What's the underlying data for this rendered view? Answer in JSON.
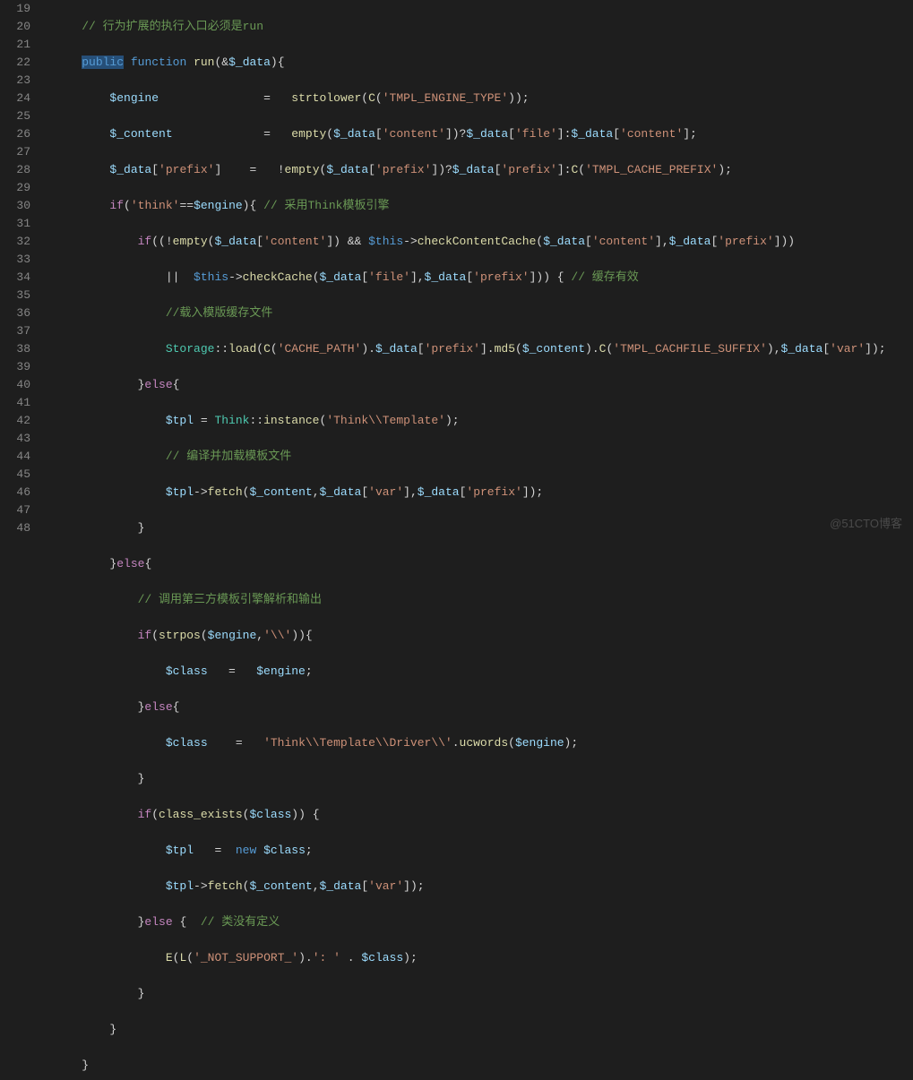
{
  "line_start": 19,
  "line_end": 48,
  "watermark": "@51CTO博客",
  "lines": {
    "l19": {
      "indent": "    ",
      "cmt": "// 行为扩展的执行入口必须是run"
    },
    "l20": {
      "indent": "    ",
      "pub": "public",
      "fn": "function",
      "name": "run",
      "op1": "(&",
      "var": "$_data",
      "op2": "){"
    },
    "l21": {
      "indent": "        ",
      "v1": "$engine",
      "pad": "               ",
      "eq": "=   ",
      "fn": "strtolower",
      "o1": "(",
      "fn2": "C",
      "o2": "(",
      "s": "'TMPL_ENGINE_TYPE'",
      "o3": "));"
    },
    "l22": {
      "indent": "        ",
      "v": "$_content",
      "pad": "             ",
      "eq": "=   ",
      "fn": "empty",
      "o1": "(",
      "v2": "$_data",
      "o2": "[",
      "s1": "'content'",
      "o3": "])?",
      "v3": "$_data",
      "o4": "[",
      "s2": "'file'",
      "o5": "]:",
      "v4": "$_data",
      "o6": "[",
      "s3": "'content'",
      "o7": "];"
    },
    "l23": {
      "indent": "        ",
      "v": "$_data",
      "o1": "[",
      "s1": "'prefix'",
      "o2": "]",
      "pad": "    ",
      "eq": "=   !",
      "fn": "empty",
      "o3": "(",
      "v2": "$_data",
      "o4": "[",
      "s2": "'prefix'",
      "o5": "])?",
      "v3": "$_data",
      "o6": "[",
      "s3": "'prefix'",
      "o7": "]:",
      "fn2": "C",
      "o8": "(",
      "s4": "'TMPL_CACHE_PREFIX'",
      "o9": ");"
    },
    "l24": {
      "indent": "        ",
      "if": "if",
      "o1": "(",
      "s": "'think'",
      "op": "==",
      "v": "$engine",
      "o2": "){ ",
      "cmt": "// 采用Think模板引擎"
    },
    "l25": {
      "indent": "            ",
      "if": "if",
      "o1": "((!",
      "fn": "empty",
      "o2": "(",
      "v1": "$_data",
      "o3": "[",
      "s1": "'content'",
      "o4": "]) && ",
      "th": "$this",
      "o5": "->",
      "fn2": "checkContentCache",
      "o6": "(",
      "v2": "$_data",
      "o7": "[",
      "s2": "'content'",
      "o8": "],",
      "v3": "$_data",
      "o9": "[",
      "s3": "'prefix'",
      "o10": "]))"
    },
    "l26": {
      "indent": "                ",
      "o1": "||  ",
      "th": "$this",
      "o2": "->",
      "fn": "checkCache",
      "o3": "(",
      "v1": "$_data",
      "o4": "[",
      "s1": "'file'",
      "o5": "],",
      "v2": "$_data",
      "o6": "[",
      "s2": "'prefix'",
      "o7": "])) { ",
      "cmt": "// 缓存有效"
    },
    "l27": {
      "indent": "                ",
      "cmt": "//载入模版缓存文件"
    },
    "l28": {
      "indent": "                ",
      "cls": "Storage",
      "o1": "::",
      "fn": "load",
      "o2": "(",
      "fn2": "C",
      "o3": "(",
      "s1": "'CACHE_PATH'",
      "o4": ").",
      "v1": "$_data",
      "o5": "[",
      "s2": "'prefix'",
      "o6": "].",
      "fn3": "md5",
      "o7": "(",
      "v2": "$_content",
      "o8": ").",
      "fn4": "C",
      "o9": "(",
      "s3": "'TMPL_CACHFILE_SUFFIX'",
      "o10": "),",
      "v3": "$_data",
      "o11": "[",
      "s4": "'var'",
      "o12": "]);"
    },
    "l29": {
      "indent": "            }",
      "els": "else",
      "o": "{"
    },
    "l30": {
      "indent": "                ",
      "v": "$tpl",
      "eq": " = ",
      "cls": "Think",
      "o1": "::",
      "fn": "instance",
      "o2": "(",
      "s": "'Think\\\\Template'",
      "o3": ");"
    },
    "l31": {
      "indent": "                ",
      "cmt": "// 编译并加载模板文件"
    },
    "l32": {
      "indent": "                ",
      "v": "$tpl",
      "o1": "->",
      "fn": "fetch",
      "o2": "(",
      "v2": "$_content",
      "o3": ",",
      "v3": "$_data",
      "o4": "[",
      "s1": "'var'",
      "o5": "],",
      "v4": "$_data",
      "o6": "[",
      "s2": "'prefix'",
      "o7": "]);"
    },
    "l33": {
      "indent": "            }",
      "txt": ""
    },
    "l34": {
      "indent": "        }",
      "els": "else",
      "o": "{"
    },
    "l35": {
      "indent": "            ",
      "cmt": "// 调用第三方模板引擎解析和输出"
    },
    "l36": {
      "indent": "            ",
      "if": "if",
      "o1": "(",
      "fn": "strpos",
      "o2": "(",
      "v": "$engine",
      "o3": ",",
      "s": "'\\\\'",
      "o4": ")){"
    },
    "l37": {
      "indent": "                ",
      "v1": "$class",
      "eq": "   =   ",
      "v2": "$engine",
      "o": ";"
    },
    "l38": {
      "indent": "            }",
      "els": "else",
      "o": "{"
    },
    "l39": {
      "indent": "                ",
      "v": "$class",
      "eq": "    =   ",
      "s": "'Think\\\\Template\\\\Driver\\\\'",
      "o1": ".",
      "fn": "ucwords",
      "o2": "(",
      "v2": "$engine",
      "o3": ");"
    },
    "l40": {
      "indent": "            }",
      "txt": ""
    },
    "l41": {
      "indent": "            ",
      "if": "if",
      "o1": "(",
      "fn": "class_exists",
      "o2": "(",
      "v": "$class",
      "o3": ")) {"
    },
    "l42": {
      "indent": "                ",
      "v": "$tpl",
      "eq": "   =  ",
      "new": "new",
      "sp": " ",
      "v2": "$class",
      "o": ";"
    },
    "l43": {
      "indent": "                ",
      "v": "$tpl",
      "o1": "->",
      "fn": "fetch",
      "o2": "(",
      "v2": "$_content",
      "o3": ",",
      "v3": "$_data",
      "o4": "[",
      "s": "'var'",
      "o5": "]);"
    },
    "l44": {
      "indent": "            }",
      "els": "else",
      "o": " {  ",
      "cmt": "// 类没有定义"
    },
    "l45": {
      "indent": "                ",
      "fn": "E",
      "o1": "(",
      "fn2": "L",
      "o2": "(",
      "s1": "'_NOT_SUPPORT_'",
      "o3": ").",
      "s2": "': '",
      "o4": " . ",
      "v": "$class",
      "o5": ");"
    },
    "l46": {
      "indent": "            }",
      "txt": ""
    },
    "l47": {
      "indent": "        }",
      "txt": ""
    },
    "l48": {
      "indent": "    }",
      "txt": ""
    }
  }
}
